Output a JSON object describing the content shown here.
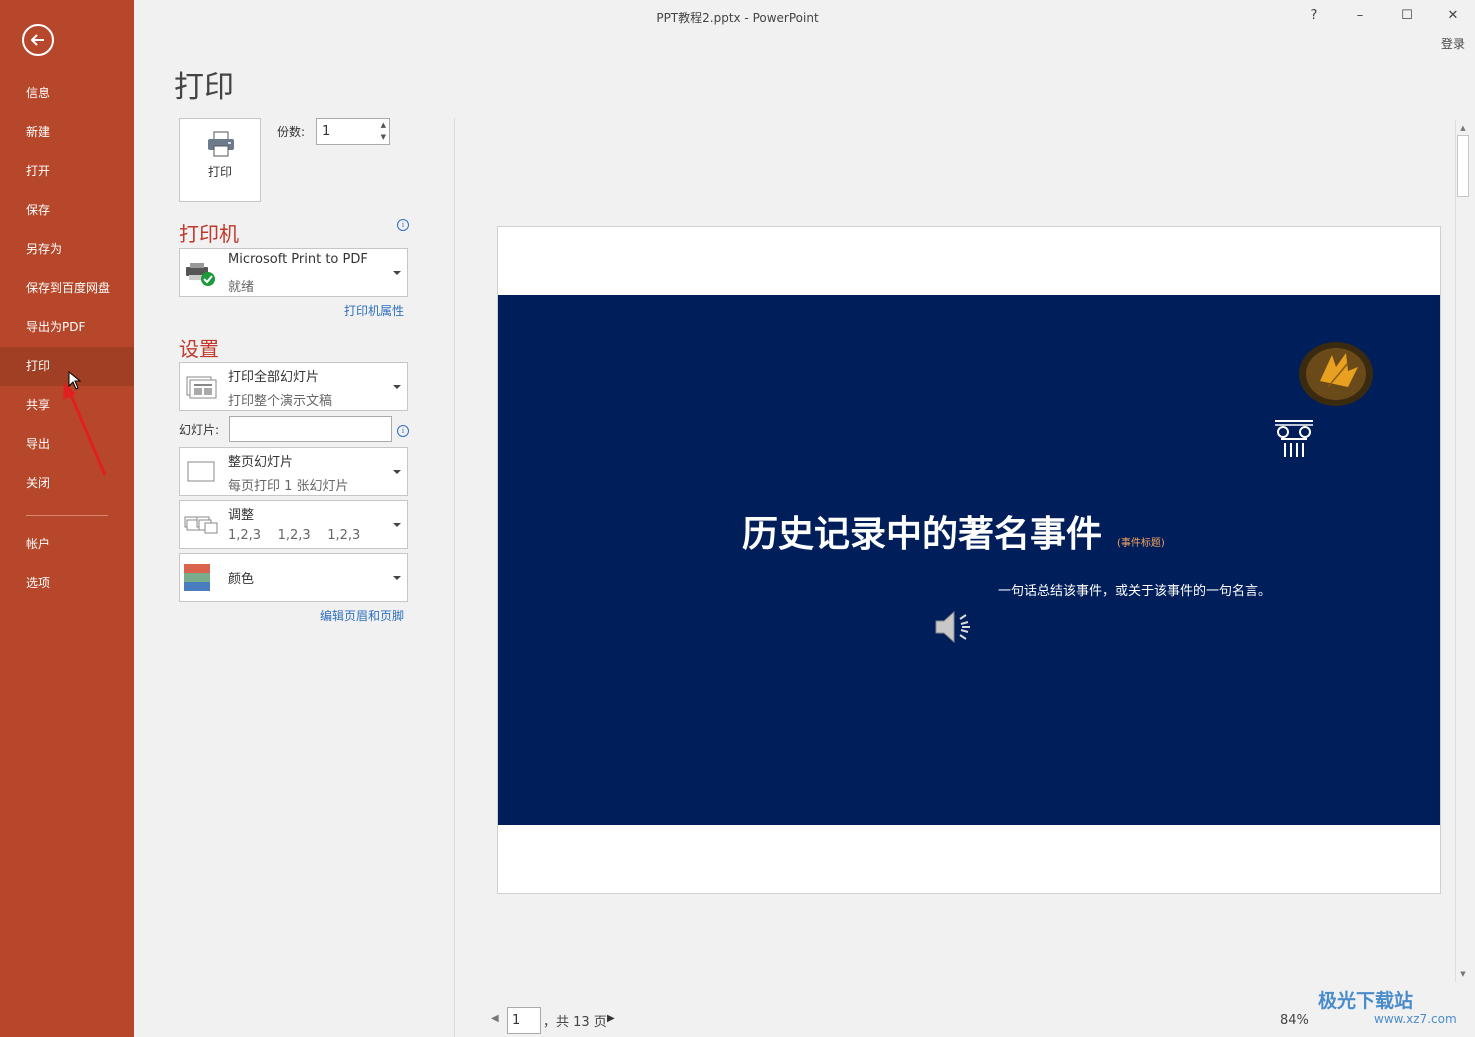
{
  "window": {
    "title": "PPT教程2.pptx - PowerPoint",
    "help_label": "?",
    "minimize_label": "–",
    "maximize_label": "☐",
    "close_label": "✕",
    "login_label": "登录"
  },
  "sidebar": {
    "items": [
      {
        "label": "信息"
      },
      {
        "label": "新建"
      },
      {
        "label": "打开"
      },
      {
        "label": "保存"
      },
      {
        "label": "另存为"
      },
      {
        "label": "保存到百度网盘"
      },
      {
        "label": "导出为PDF"
      },
      {
        "label": "打印"
      },
      {
        "label": "共享"
      },
      {
        "label": "导出"
      },
      {
        "label": "关闭"
      }
    ],
    "bottom_items": [
      {
        "label": "帐户"
      },
      {
        "label": "选项"
      }
    ],
    "active": "打印",
    "accent": "#b7472a"
  },
  "print": {
    "page_title": "打印",
    "print_button_label": "打印",
    "copies_label": "份数:",
    "copies_value": "1",
    "printer_heading": "打印机",
    "printer_name": "Microsoft Print to PDF",
    "printer_status": "就绪",
    "printer_properties_link": "打印机属性",
    "settings_heading": "设置",
    "range_title": "打印全部幻灯片",
    "range_sub": "打印整个演示文稿",
    "slides_label": "幻灯片:",
    "slides_value": "",
    "layout_title": "整页幻灯片",
    "layout_sub": "每页打印 1 张幻灯片",
    "collate_title": "调整",
    "collate_sub": "1,2,3    1,2,3    1,2,3",
    "color_title": "颜色",
    "header_footer_link": "编辑页眉和页脚",
    "heading_color": "#c0392b"
  },
  "preview": {
    "slide_title": "历史记录中的著名事件",
    "slide_title_note": "(事件标题)",
    "slide_subtitle": "一句话总结该事件，或关于该事件的一句名言。",
    "slide_bg": "#001e5a",
    "current_page": "1",
    "page_total_text": "，共 13 页",
    "zoom": "84%"
  },
  "watermark": {
    "text": "极光下载站",
    "url": "www.xz7.com"
  }
}
